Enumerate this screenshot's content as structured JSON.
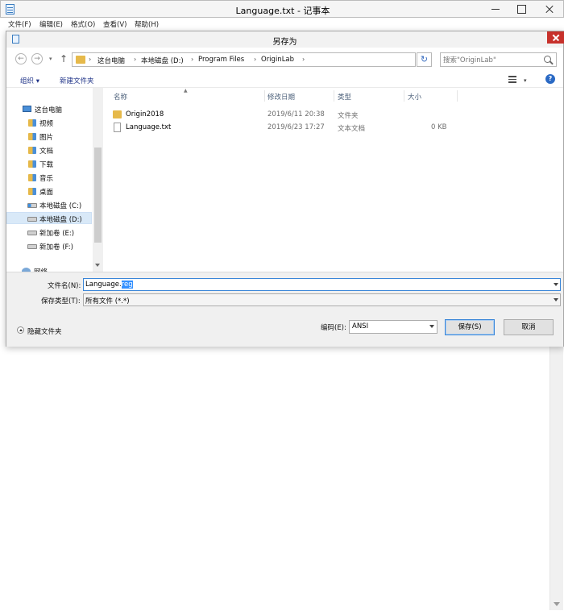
{
  "notepad": {
    "title": "Language.txt - 记事本",
    "menu": [
      "文件(F)",
      "编辑(E)",
      "格式(O)",
      "查看(V)",
      "帮助(H)"
    ]
  },
  "dialog": {
    "title": "另存为",
    "breadcrumbs": [
      "这台电脑",
      "本地磁盘 (D:)",
      "Program Files",
      "OriginLab"
    ],
    "search_placeholder": "搜索\"OriginLab\"",
    "toolbar": {
      "organize": "组织 ▾",
      "new_folder": "新建文件夹"
    },
    "nav_items": [
      {
        "label": "这台电脑",
        "icon": "computer-icon"
      },
      {
        "label": "视频",
        "icon": "folder-icon"
      },
      {
        "label": "图片",
        "icon": "folder-icon"
      },
      {
        "label": "文档",
        "icon": "folder-icon"
      },
      {
        "label": "下载",
        "icon": "folder-icon"
      },
      {
        "label": "音乐",
        "icon": "folder-icon"
      },
      {
        "label": "桌面",
        "icon": "folder-icon"
      },
      {
        "label": "本地磁盘 (C:)",
        "icon": "drive-icon"
      },
      {
        "label": "本地磁盘 (D:)",
        "icon": "drive-icon"
      },
      {
        "label": "新加卷 (E:)",
        "icon": "drive-icon"
      },
      {
        "label": "新加卷 (F:)",
        "icon": "drive-icon"
      },
      {
        "label": "网络",
        "icon": "network-icon"
      }
    ],
    "columns": [
      "名称",
      "修改日期",
      "类型",
      "大小"
    ],
    "files": [
      {
        "name": "Origin2018",
        "modified": "2019/6/11 20:38",
        "type": "文件夹",
        "size": ""
      },
      {
        "name": "Language.txt",
        "modified": "2019/6/23 17:27",
        "type": "文本文档",
        "size": "0 KB"
      }
    ],
    "filename_label": "文件名(N):",
    "filename_value_plain": "Language.",
    "filename_value_selected": "reg",
    "filetype_label": "保存类型(T):",
    "filetype_value": "所有文件  (*.*)",
    "hide_folders": "隐藏文件夹",
    "encoding_label": "编码(E):",
    "encoding_value": "ANSI",
    "save_button": "保存(S)",
    "cancel_button": "取消"
  }
}
